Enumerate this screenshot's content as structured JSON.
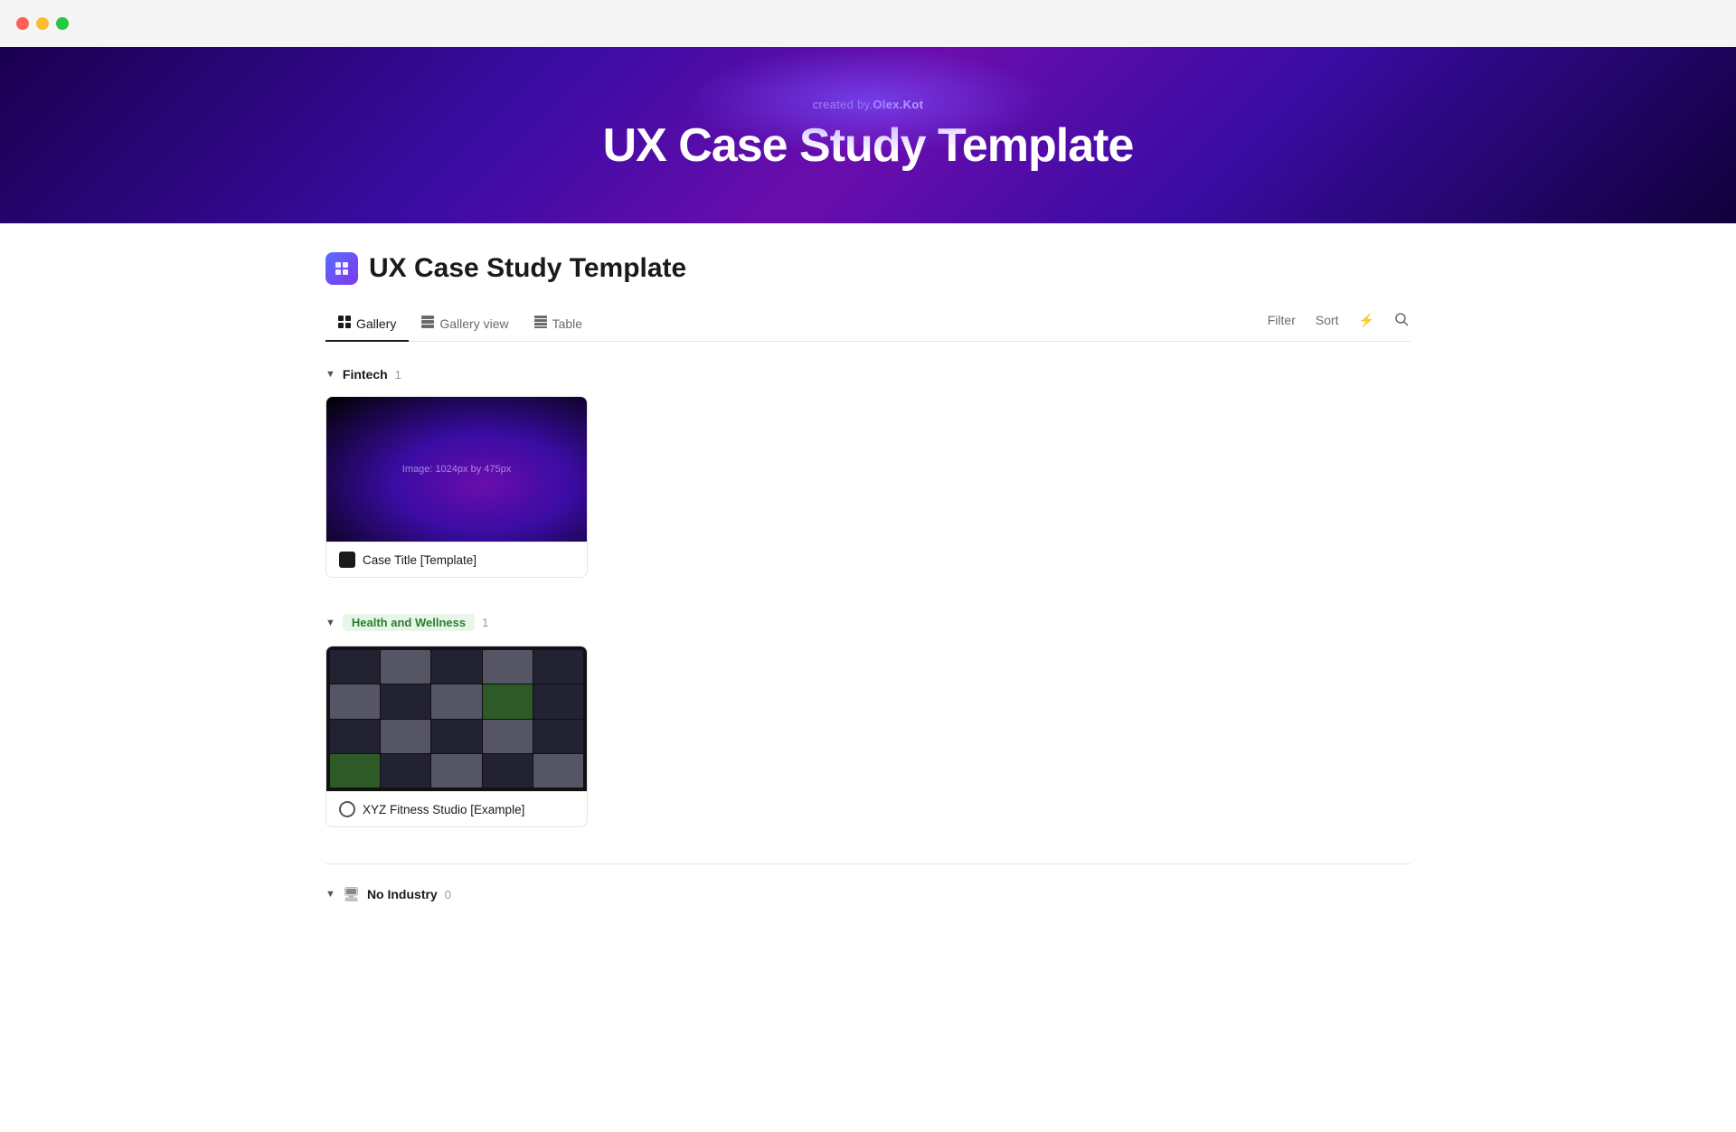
{
  "titlebar": {
    "traffic_lights": [
      "red",
      "yellow",
      "green"
    ]
  },
  "hero": {
    "created_by_prefix": "created by.",
    "created_by_name": "Olex.Kot",
    "title": "UX Case Study Template"
  },
  "page": {
    "icon": "⚡",
    "title": "UX Case Study Template"
  },
  "tabs": [
    {
      "label": "Gallery",
      "icon": "⊞",
      "active": true
    },
    {
      "label": "Gallery view",
      "icon": "⊟",
      "active": false
    },
    {
      "label": "Table",
      "icon": "⊞",
      "active": false
    }
  ],
  "toolbar": {
    "filter_label": "Filter",
    "sort_label": "Sort",
    "lightning_icon": "⚡",
    "search_icon": "🔍"
  },
  "groups": [
    {
      "id": "fintech",
      "label": "Fintech",
      "label_type": "plain",
      "count": 1,
      "cards": [
        {
          "id": "case-title-template",
          "image_type": "fintech",
          "image_text": "Image: 1024px by 475px",
          "footer_icon_type": "dark",
          "title": "Case Title [Template]"
        }
      ]
    },
    {
      "id": "health-wellness",
      "label": "Health and Wellness",
      "label_type": "tag",
      "count": 1,
      "cards": [
        {
          "id": "xyz-fitness",
          "image_type": "fitness",
          "image_text": "",
          "footer_icon_type": "ring",
          "title": "XYZ Fitness Studio [Example]"
        }
      ]
    },
    {
      "id": "no-industry",
      "label": "No Industry",
      "label_type": "plain",
      "icon": "monitor",
      "count": 0,
      "cards": []
    }
  ]
}
